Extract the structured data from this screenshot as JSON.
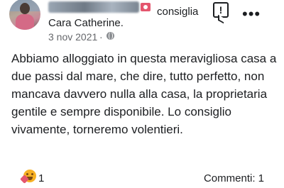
{
  "post": {
    "recommend_label": "consiglia",
    "greeting": "Cara Catherine.",
    "date": "3 nov 2021",
    "separator": "·",
    "body": "Abbiamo alloggiato in questa meravigliosa casa a due passi dal mare, che dire, tutto perfetto, non mancava davvero nulla alla casa, la proprietaria gentile e sempre disponibile. Lo consiglio vivamente, torneremo volentieri."
  },
  "actions": {
    "report_symbol": "!",
    "more_symbol": "•••"
  },
  "footer": {
    "reaction_count": "1",
    "comments_label": "Commenti: 1"
  },
  "icons": {
    "avatar": "profile-photo",
    "recommend": "recommend-icon",
    "audience": "globe-icon",
    "report": "report-icon",
    "more": "more-options-icon",
    "reaction": "care-reaction-icon"
  },
  "colors": {
    "text": "#1c1e21",
    "secondary": "#65676b",
    "recommend_accent": "#e4566e",
    "reaction_yellow": "#f7b125"
  }
}
